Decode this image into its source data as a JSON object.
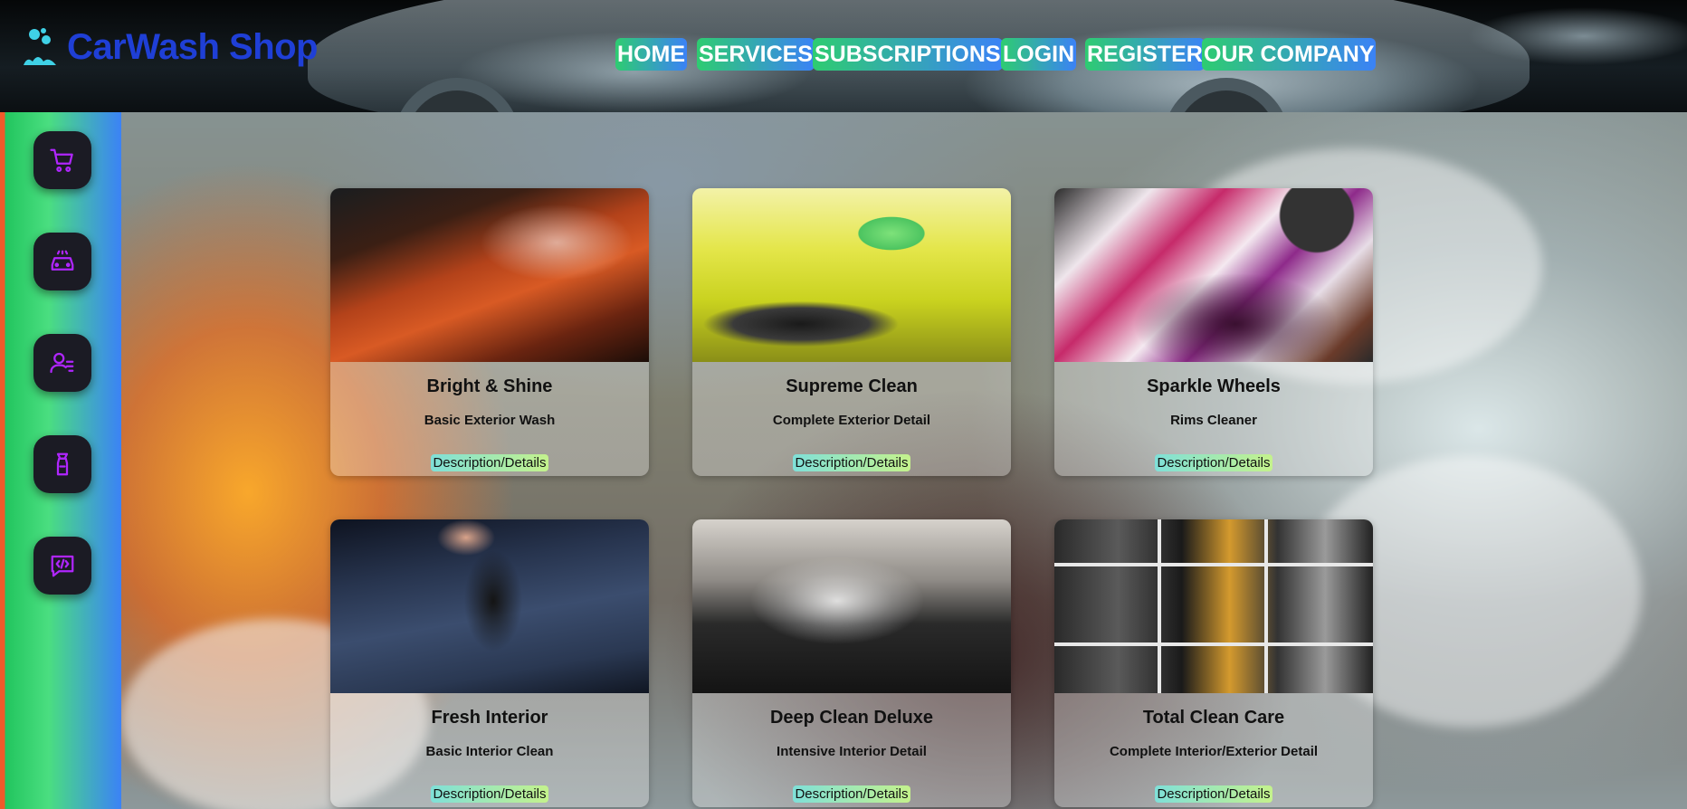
{
  "brand": {
    "title": "CarWash Shop",
    "icon": "washing-bubbles-icon"
  },
  "nav": {
    "items": [
      {
        "label": "HOME"
      },
      {
        "label": "SERVICES"
      },
      {
        "label": "SUBSCRIPTIONS"
      },
      {
        "label": "LOGIN"
      },
      {
        "label": "REGISTER"
      },
      {
        "label": "OUR COMPANY"
      }
    ]
  },
  "sidebar": {
    "items": [
      {
        "icon": "cart-icon"
      },
      {
        "icon": "car-icon"
      },
      {
        "icon": "user-list-icon"
      },
      {
        "icon": "spray-bottle-icon"
      },
      {
        "icon": "code-message-icon"
      }
    ]
  },
  "services": [
    {
      "title": "Bright & Shine",
      "subtitle": "Basic Exterior Wash",
      "link": "Description/Details"
    },
    {
      "title": "Supreme Clean",
      "subtitle": "Complete Exterior Detail",
      "link": "Description/Details"
    },
    {
      "title": "Sparkle Wheels",
      "subtitle": "Rims Cleaner",
      "link": "Description/Details"
    },
    {
      "title": "Fresh Interior",
      "subtitle": "Basic Interior Clean",
      "link": "Description/Details"
    },
    {
      "title": "Deep Clean Deluxe",
      "subtitle": "Intensive Interior Detail",
      "link": "Description/Details"
    },
    {
      "title": "Total Clean Care",
      "subtitle": "Complete Interior/Exterior Detail",
      "link": "Description/Details"
    }
  ],
  "colors": {
    "brand": "#1f3fd6",
    "nav_gradient_start": "#2ecc71",
    "nav_gradient_end": "#3b82f6",
    "sidebar_icon": "#b026ff",
    "link_gradient_start": "#7fe0d8",
    "link_gradient_end": "#c4f28c"
  }
}
